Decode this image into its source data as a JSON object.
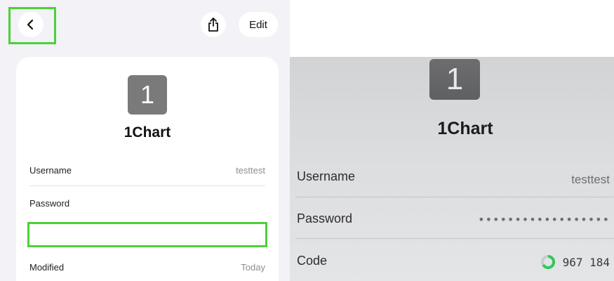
{
  "app_view": {
    "edit_label": "Edit",
    "tile_char": "1",
    "title": "1Chart",
    "username_label": "Username",
    "username_value": "testtest",
    "password_label": "Password",
    "modified_label": "Modified",
    "modified_value": "Today"
  },
  "photo_view": {
    "tile_char": "1",
    "title": "1Chart",
    "username_label": "Username",
    "username_value": "testtest",
    "password_label": "Password",
    "password_mask": "••••••••••••••••••",
    "code_label": "Code",
    "code_value": "967 184"
  },
  "colors": {
    "highlight": "#4cd137",
    "tile": "#7a7a7a",
    "code_ring": "#34c759"
  },
  "icons": [
    "chevron-left-icon",
    "share-icon",
    "code-timer-ring-icon"
  ]
}
